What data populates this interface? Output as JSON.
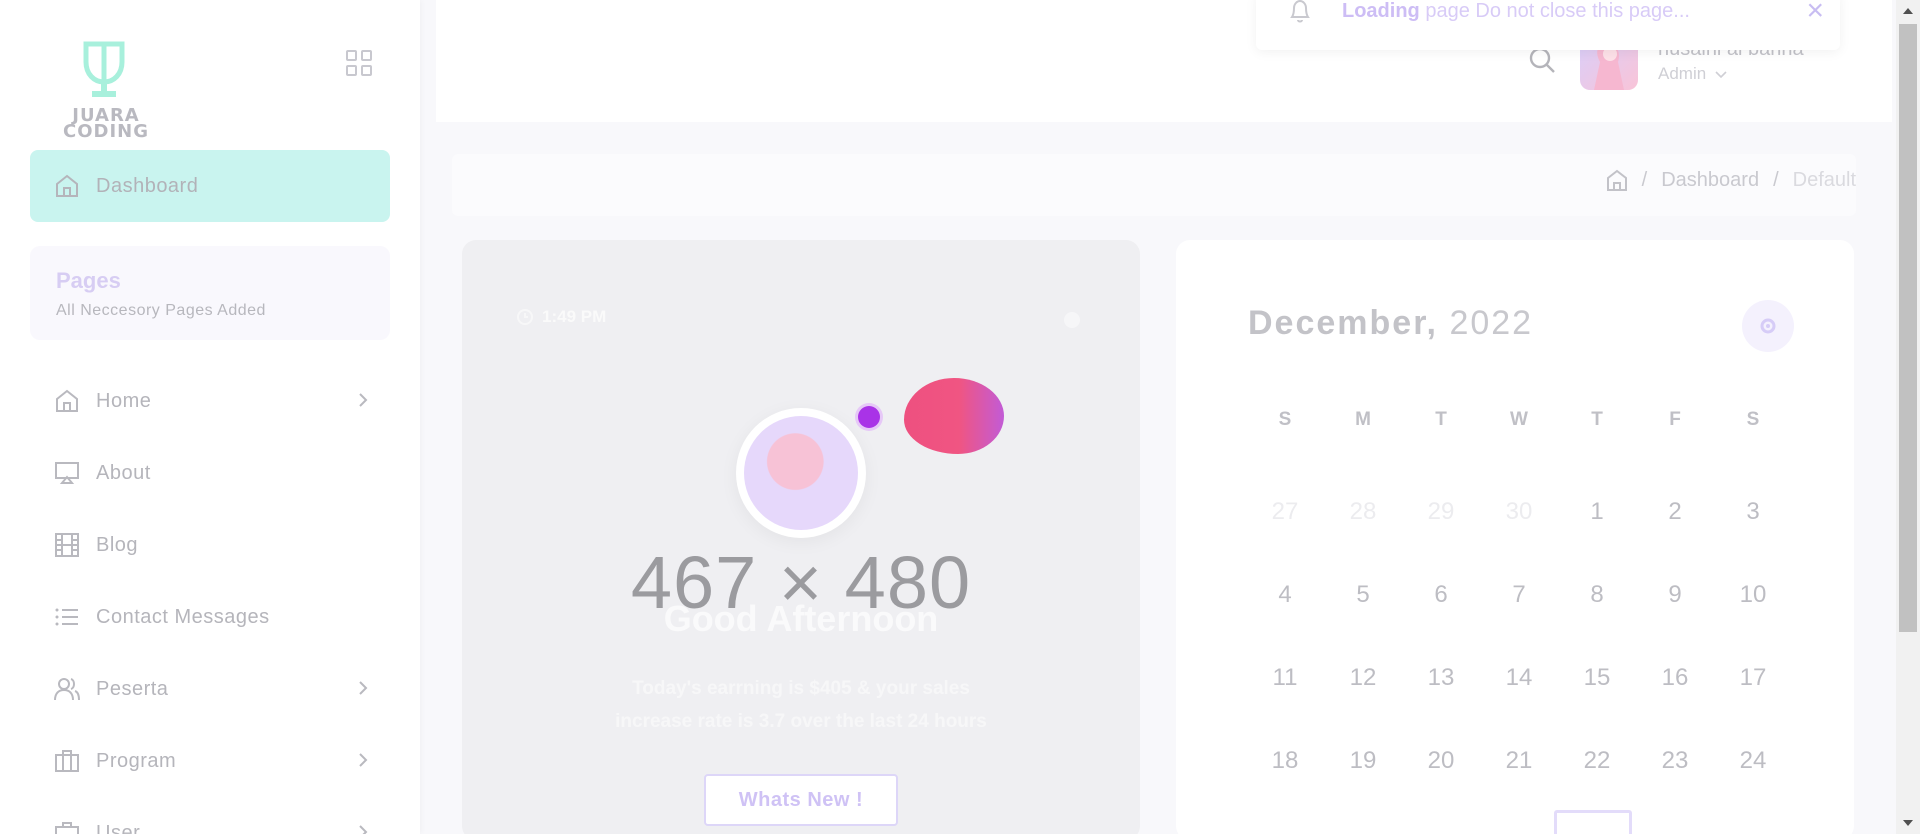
{
  "brand": {
    "logo_line1": "JUARA",
    "logo_line2": "CODING"
  },
  "sidebar": {
    "active": {
      "label": "Dashboard",
      "icon": "home-icon"
    },
    "pages_card": {
      "title": "Pages",
      "subtitle": "All Neccesory Pages Added"
    },
    "items": [
      {
        "label": "Home",
        "icon": "home-icon",
        "chevron": true
      },
      {
        "label": "About",
        "icon": "monitor-icon",
        "chevron": false
      },
      {
        "label": "Blog",
        "icon": "film-icon",
        "chevron": false
      },
      {
        "label": "Contact Messages",
        "icon": "list-icon",
        "chevron": false
      },
      {
        "label": "Peserta",
        "icon": "users-icon",
        "chevron": true
      },
      {
        "label": "Program",
        "icon": "briefcase-icon",
        "chevron": true
      },
      {
        "label": "User",
        "icon": "briefcase-icon",
        "chevron": true
      }
    ]
  },
  "header": {
    "user_name": "husaini al banna",
    "user_role": "Admin"
  },
  "toast": {
    "bold": "Loading",
    "text": " page Do not close this page..."
  },
  "breadcrumb": {
    "items": [
      "Dashboard",
      "Default"
    ]
  },
  "welcome": {
    "time": "1:49 PM",
    "placeholder": "467 × 480",
    "greeting": "Good Afternoon",
    "earning_line1": "Today's earrning is $405 & your sales",
    "earning_line2": "increase rate is 3.7 over the last 24 hours",
    "button": "Whats New !"
  },
  "calendar": {
    "month": "December,",
    "year": "2022",
    "weekdays": [
      "S",
      "M",
      "T",
      "W",
      "T",
      "F",
      "S"
    ],
    "rows": [
      [
        "27",
        "28",
        "29",
        "30",
        "1",
        "2",
        "3"
      ],
      [
        "4",
        "5",
        "6",
        "7",
        "8",
        "9",
        "10"
      ],
      [
        "11",
        "12",
        "13",
        "14",
        "15",
        "16",
        "17"
      ],
      [
        "18",
        "19",
        "20",
        "21",
        "22",
        "23",
        "24"
      ]
    ]
  },
  "colors": {
    "accent": "#c9f4ef",
    "primary": "#7366ff",
    "blob": "#ee5080"
  }
}
